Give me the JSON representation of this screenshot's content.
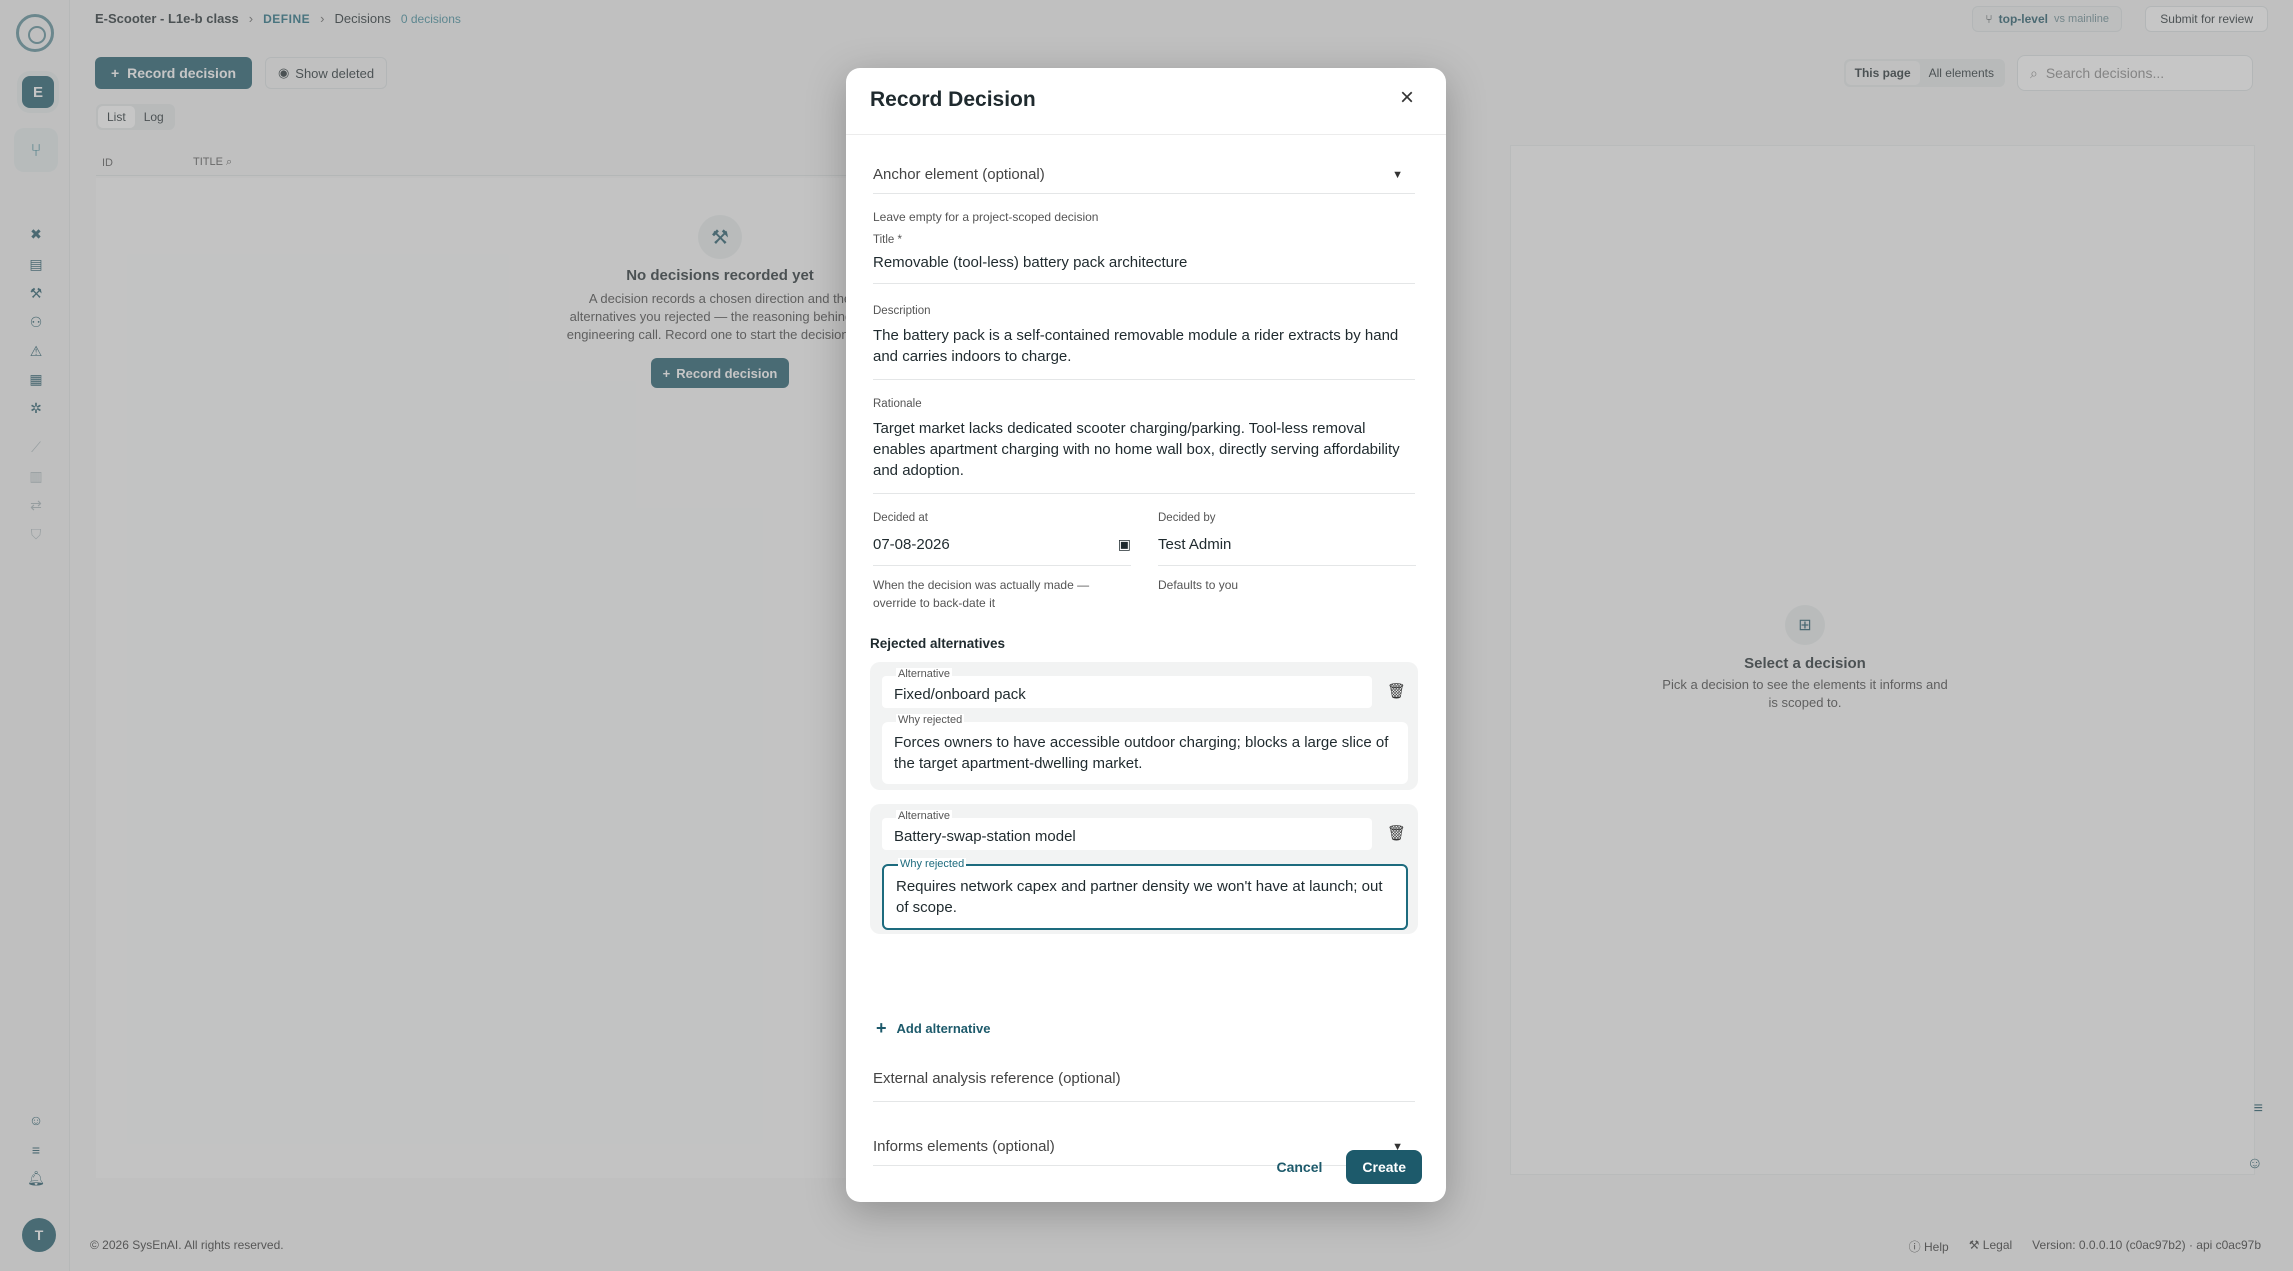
{
  "topbar": {
    "project": "E-Scooter - L1e-b class",
    "phase": "DEFINE",
    "page": "Decisions",
    "count": "0 decisions",
    "branch": "top-level",
    "vs": "vs mainline",
    "submit": "Submit for review"
  },
  "sidebar": {
    "workspace_initial": "E",
    "user_initial": "T"
  },
  "page": {
    "record_button": "Record decision",
    "show_deleted": "Show deleted",
    "tabs": [
      "List",
      "Log"
    ],
    "col_id": "ID",
    "col_title": "TITLE",
    "empty_title": "No decisions recorded yet",
    "empty_text": "A decision records a chosen direction and the alternatives you rejected — the reasoning behind an engineering call. Record one to start the decision log.",
    "empty_button": "Record decision",
    "scope_this_page": "This page",
    "scope_all": "All elements",
    "search_placeholder": "Search decisions...",
    "select_title": "Select a decision",
    "select_text": "Pick a decision to see the elements it informs and is scoped to."
  },
  "footer": {
    "copyright": "© 2026 SysEnAI. All rights reserved.",
    "help": "Help",
    "legal": "Legal",
    "version": "Version: 0.0.0.10 (c0ac97b2) · api c0ac97b"
  },
  "modal": {
    "title": "Record Decision",
    "anchor_placeholder": "Anchor element (optional)",
    "anchor_helper": "Leave empty for a project-scoped decision",
    "title_label": "Title *",
    "title_value": "Removable (tool-less) battery pack architecture",
    "description_label": "Description",
    "description_value": "The battery pack is a self-contained removable module a rider extracts by hand and carries indoors to charge.",
    "rationale_label": "Rationale",
    "rationale_value": "Target market lacks dedicated scooter charging/parking. Tool-less removal enables apartment charging with no home wall box, directly serving affordability and adoption.",
    "decided_at_label": "Decided at",
    "decided_at_value": "07-08-2026",
    "decided_at_helper": "When the decision was actually made — override to back-date it",
    "decided_by_label": "Decided by",
    "decided_by_value": "Test Admin",
    "decided_by_helper": "Defaults to you",
    "rejected_title": "Rejected alternatives",
    "alternatives": [
      {
        "alt_label": "Alternative",
        "alt_value": "Fixed/onboard pack",
        "why_label": "Why rejected",
        "why_value": "Forces owners to have accessible outdoor charging; blocks a large slice of the target apartment-dwelling market."
      },
      {
        "alt_label": "Alternative",
        "alt_value": "Battery-swap-station model",
        "why_label": "Why rejected",
        "why_value": "Requires network capex and partner density we won't have at launch; out of scope."
      }
    ],
    "add_alternative": "Add alternative",
    "external_placeholder": "External analysis reference (optional)",
    "informs_placeholder": "Informs elements (optional)",
    "cancel": "Cancel",
    "create": "Create"
  }
}
